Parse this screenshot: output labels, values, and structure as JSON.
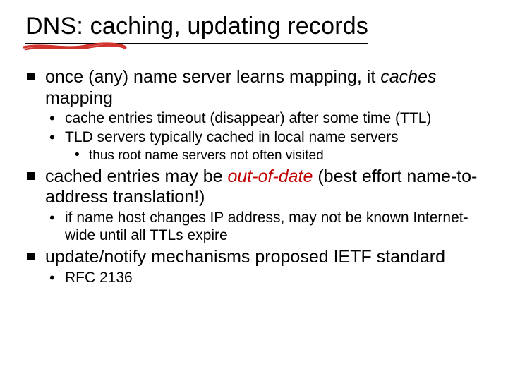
{
  "title": "DNS: caching, updating records",
  "b1": {
    "p1a": "once (any) name server learns mapping, it ",
    "p1b_ital": "caches",
    "p1c": " mapping",
    "s1": "cache entries timeout (disappear) after some time (TTL)",
    "s2": "TLD servers typically cached in local name servers",
    "s2a": "thus root name servers not often visited"
  },
  "b2": {
    "p1a": "cached entries may be ",
    "p1b_redital": "out-of-date",
    "p1c": " (best effort name-to-address translation!)",
    "s1": "if name host changes IP address, may not be known Internet-wide until all TTLs expire"
  },
  "b3": {
    "p1": "update/notify mechanisms proposed IETF standard",
    "s1": "RFC 2136"
  }
}
